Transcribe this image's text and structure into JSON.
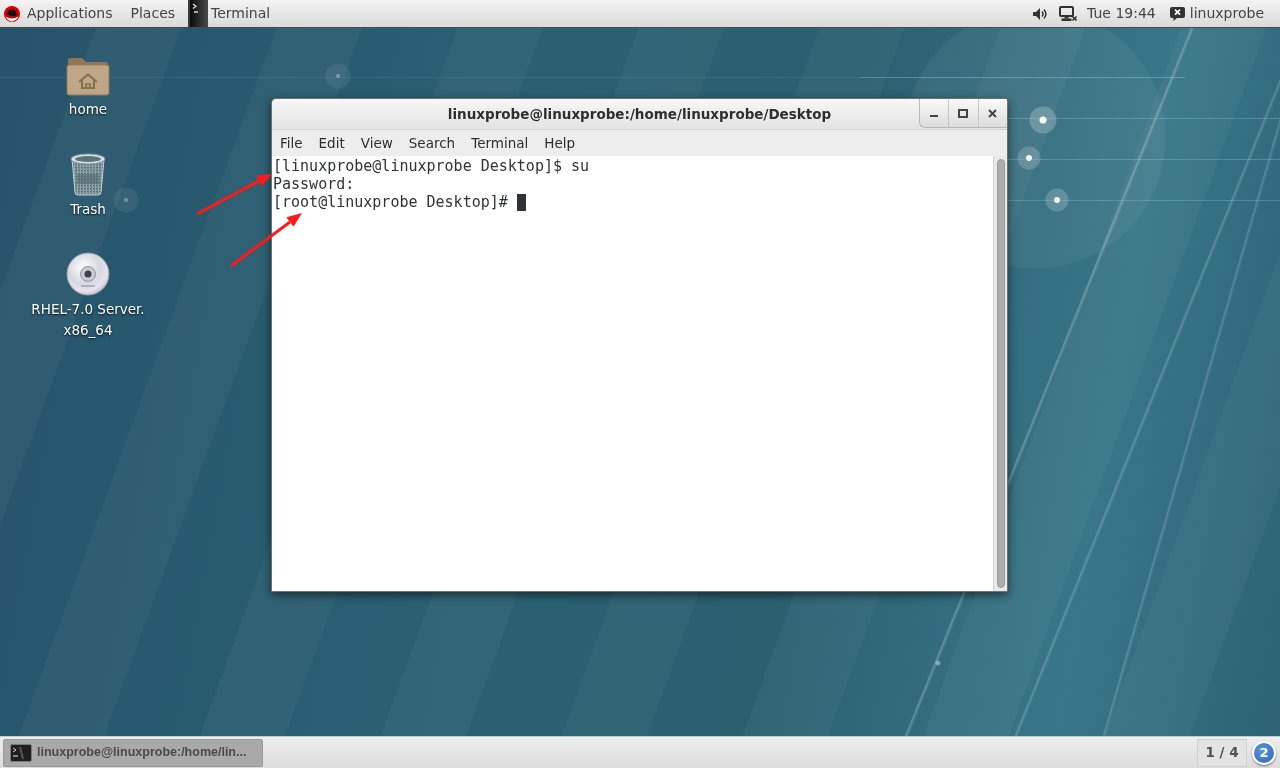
{
  "top_bar": {
    "applications_menu": {
      "label": "Applications"
    },
    "places_menu": {
      "label": "Places"
    },
    "app_menu": {
      "label": "Terminal"
    },
    "clock": "Tue 19:44",
    "user": "linuxprobe"
  },
  "desktop_icons": [
    {
      "kind": "folder",
      "label": "home"
    },
    {
      "kind": "trash",
      "label": "Trash"
    },
    {
      "kind": "disc",
      "label": "RHEL-7.0 Server. x86_64"
    }
  ],
  "terminal_window": {
    "title": "linuxprobe@linuxprobe:/home/linuxprobe/Desktop",
    "menu": [
      "File",
      "Edit",
      "View",
      "Search",
      "Terminal",
      "Help"
    ],
    "lines": [
      {
        "text": "[linuxprobe@linuxprobe Desktop]$ su",
        "cursor": false
      },
      {
        "text": "Password:",
        "cursor": false
      },
      {
        "text": "[root@linuxprobe Desktop]#",
        "cursor": true
      }
    ]
  },
  "annotations": [
    {
      "kind": "arrow"
    },
    {
      "kind": "arrow"
    }
  ],
  "bottom_panel": {
    "windows": [
      {
        "label": "linuxprobe@linuxprobe:/home/lin...",
        "selected": true
      }
    ],
    "workspace": "1 / 4",
    "notifications": "2"
  }
}
